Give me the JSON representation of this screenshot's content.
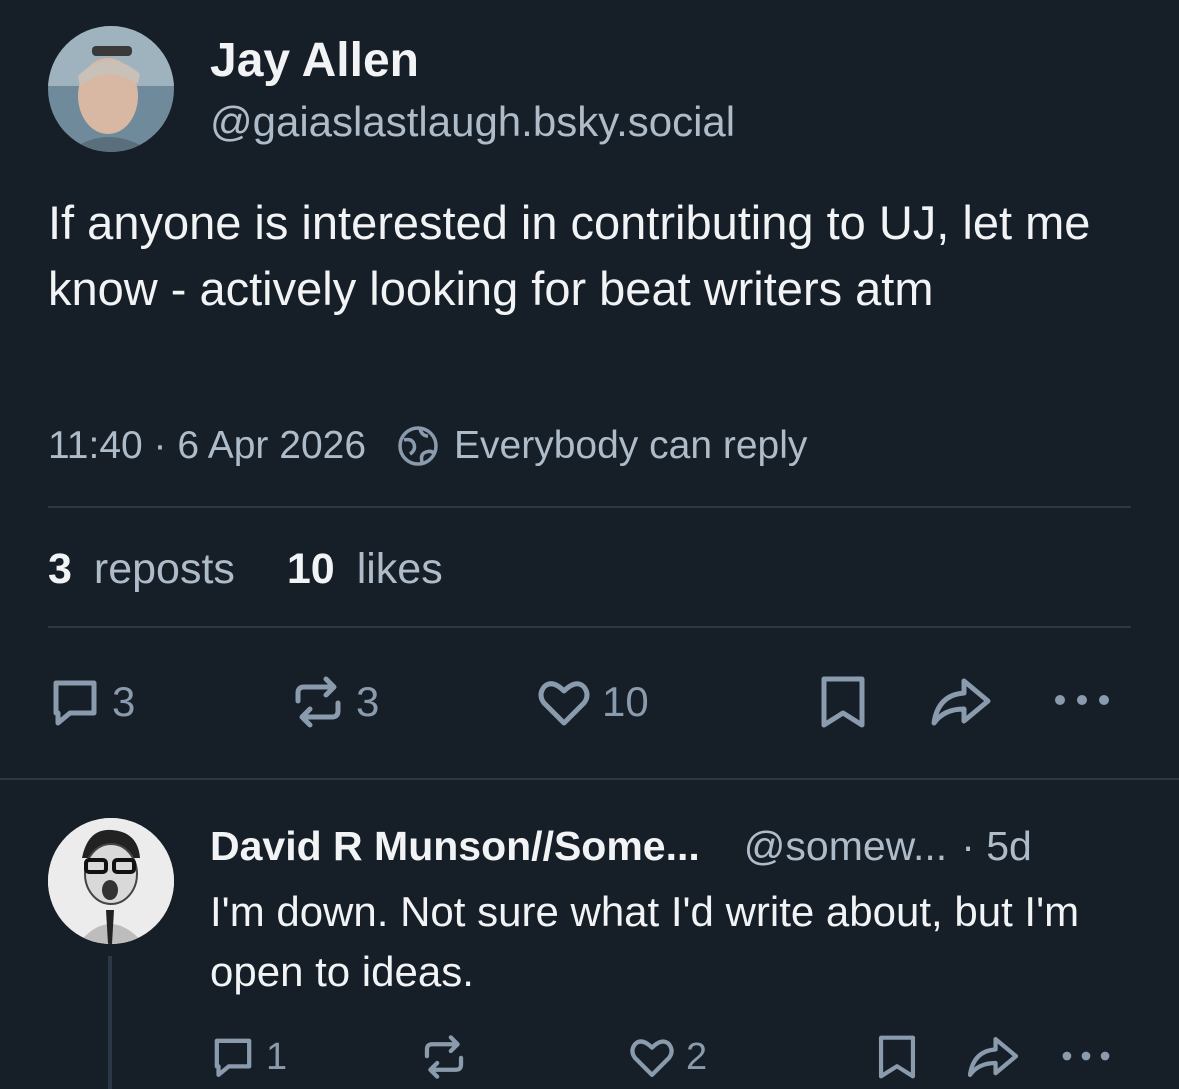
{
  "post": {
    "author_name": "Jay Allen",
    "author_handle": "@gaiaslastlaugh.bsky.social",
    "text": "If anyone is interested in contributing to UJ, let me know - actively looking for beat writers atm",
    "timestamp": "11:40 · 6 Apr 2026",
    "reply_setting": "Everybody can reply",
    "reposts_count": "3",
    "reposts_label": "reposts",
    "likes_count": "10",
    "likes_label": "likes",
    "actions": {
      "reply_count": "3",
      "repost_count": "3",
      "like_count": "10"
    }
  },
  "reply": {
    "author_name": "David R Munson//Some...",
    "author_handle": "@somew...",
    "age": "· 5d",
    "text": "I'm down. Not sure what I'd write about, but I'm open to ideas.",
    "actions": {
      "reply_count": "1",
      "repost_count": "",
      "like_count": "2"
    }
  },
  "colors": {
    "background": "#161e27",
    "text": "#f1f3f5",
    "muted_text": "#aebbc9",
    "icon": "#8a9bad",
    "divider": "#2b3745"
  },
  "icons": [
    "globe-icon",
    "reply-icon",
    "repost-icon",
    "heart-icon",
    "bookmark-icon",
    "share-icon",
    "more-icon"
  ]
}
